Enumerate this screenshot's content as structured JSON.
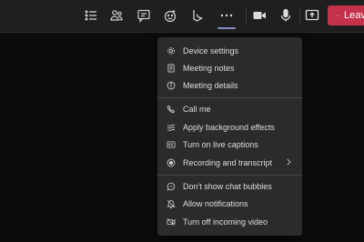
{
  "toolbar": {
    "leave_label": "Leave",
    "buttons": [
      {
        "name": "participants-list-icon"
      },
      {
        "name": "people-icon"
      },
      {
        "name": "chat-icon"
      },
      {
        "name": "reactions-icon"
      },
      {
        "name": "bing-icon"
      },
      {
        "name": "more-actions-icon"
      },
      {
        "name": "camera-icon"
      },
      {
        "name": "microphone-icon"
      },
      {
        "name": "share-screen-icon"
      }
    ],
    "colors": {
      "leave": "#c4314b",
      "active_underline": "#8b8cc7"
    }
  },
  "menu": {
    "items": [
      {
        "label": "Device settings",
        "icon": "gear-icon"
      },
      {
        "label": "Meeting notes",
        "icon": "notes-icon"
      },
      {
        "label": "Meeting details",
        "icon": "info-icon"
      },
      {
        "label": "Call me",
        "icon": "phone-icon"
      },
      {
        "label": "Apply background effects",
        "icon": "background-effects-icon"
      },
      {
        "label": "Turn on live captions",
        "icon": "captions-icon"
      },
      {
        "label": "Recording and transcript",
        "icon": "record-icon",
        "submenu": true
      },
      {
        "label": "Don't show chat bubbles",
        "icon": "chat-bubble-off-icon"
      },
      {
        "label": "Allow notifications",
        "icon": "notification-icon"
      },
      {
        "label": "Turn off incoming video",
        "icon": "video-off-icon"
      }
    ]
  }
}
